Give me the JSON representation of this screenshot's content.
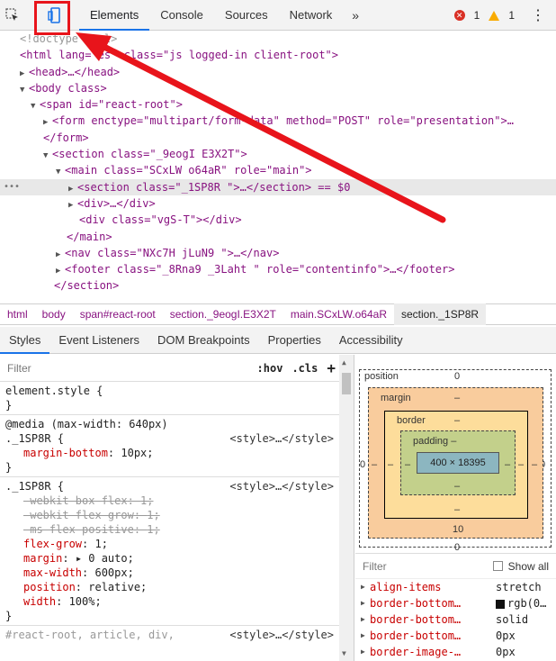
{
  "toolbar": {
    "tabs": [
      "Elements",
      "Console",
      "Sources",
      "Network"
    ],
    "more": "»",
    "errors": "1",
    "warnings": "1",
    "kebab": "⋮"
  },
  "tree": [
    {
      "t": "<!doctype html>"
    },
    {
      "t": "<html lang=\"es\" class=\"js logged-in client-root\">"
    },
    {
      "t": "<head>…</head>"
    },
    {
      "t": "<body class>"
    },
    {
      "t": "<span id=\"react-root\">"
    },
    {
      "t": "<form enctype=\"multipart/form-data\" method=\"POST\" role=\"presentation\">…"
    },
    {
      "t": "</form>"
    },
    {
      "t": "<section class=\"_9eogI E3X2T\">"
    },
    {
      "t": "<main class=\"SCxLW  o64aR\" role=\"main\">"
    },
    {
      "t": "<section class=\"_1SP8R   \">…</section> == $0"
    },
    {
      "t": "<div>…</div>"
    },
    {
      "t": "<div class=\"vgS-T\"></div>"
    },
    {
      "t": "</main>"
    },
    {
      "t": "<nav class=\"NXc7H jLuN9  \">…</nav>"
    },
    {
      "t": "<footer class=\"_8Rna9  _3Laht \" role=\"contentinfo\">…</footer>"
    },
    {
      "t": "</section>"
    }
  ],
  "breadcrumb": [
    "html",
    "body",
    "span#react-root",
    "section._9eogI.E3X2T",
    "main.SCxLW.o64aR",
    "section._1SP8R"
  ],
  "subtabs": [
    "Styles",
    "Event Listeners",
    "DOM Breakpoints",
    "Properties",
    "Accessibility"
  ],
  "styles": {
    "filter_placeholder": "Filter",
    "hov": ":hov",
    "cls": ".cls",
    "plus": "+",
    "element_style": "element.style {",
    "close": "}",
    "media": "@media (max-width: 640px)",
    "rule1_selector": "._1SP8R {",
    "rule1_source": "<style>…</style>",
    "rule1_props": [
      {
        "name": "margin-bottom",
        "value": "10px;"
      }
    ],
    "rule2_selector": "._1SP8R {",
    "rule2_source": "<style>…</style>",
    "rule2_props": [
      {
        "name": "-webkit-box-flex",
        "value": "1;",
        "struck": true
      },
      {
        "name": "-webkit-flex-grow",
        "value": "1;",
        "struck": true
      },
      {
        "name": "-ms-flex-positive",
        "value": "1;",
        "struck": true
      },
      {
        "name": "flex-grow",
        "value": "1;"
      },
      {
        "name": "margin",
        "value": "▸ 0 auto;"
      },
      {
        "name": "max-width",
        "value": "600px;"
      },
      {
        "name": "position",
        "value": "relative;"
      },
      {
        "name": "width",
        "value": "100%;"
      }
    ],
    "rule3_selector": "#react-root, article, div,",
    "rule3_source": "<style>…</style>"
  },
  "boxmodel": {
    "position_label": "position",
    "position_top": "0",
    "position_left": "0",
    "margin_label": "margin",
    "margin_top": "–",
    "margin_left": "–",
    "margin_right": "–",
    "margin_bottom": "10",
    "border_label": "border",
    "border_top": "–",
    "border_left": "–",
    "border_right": "–",
    "border_bottom": "–",
    "padding_label": "padding –",
    "padding_left": "–",
    "padding_right": "–",
    "padding_bottom": "–",
    "content": "400 × 18395",
    "bottom_zero": "0",
    "right_zero": "0",
    "left_dash": "–"
  },
  "computed": {
    "filter_placeholder": "Filter",
    "show_all": "Show all",
    "rows": [
      {
        "name": "align-items",
        "value": "stretch"
      },
      {
        "name": "border-bottom…",
        "value": "rgb(0…",
        "swatch": true
      },
      {
        "name": "border-bottom…",
        "value": "solid"
      },
      {
        "name": "border-bottom…",
        "value": "0px"
      },
      {
        "name": "border-image-…",
        "value": "0px"
      }
    ]
  },
  "colors": {
    "highlight_red": "#e8141b",
    "accent": "#1a73e8"
  }
}
